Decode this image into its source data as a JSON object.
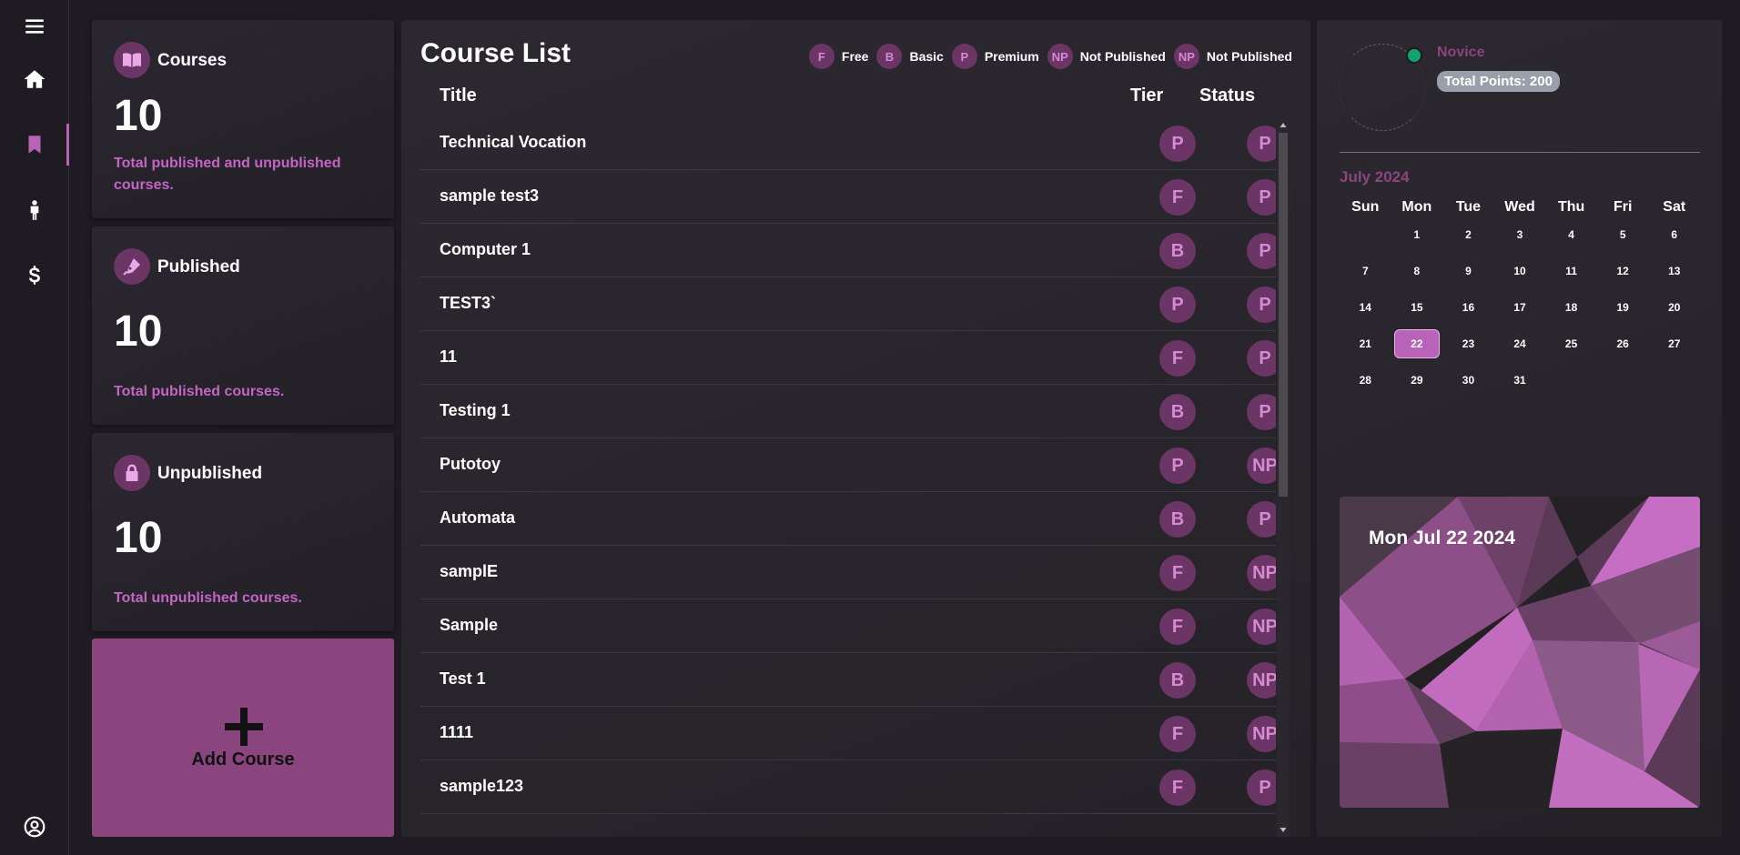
{
  "sidebar": {
    "icons": [
      "menu-icon",
      "home-icon",
      "bookmark-icon",
      "person-icon",
      "dollar-icon",
      "user-circle-icon"
    ],
    "active": "bookmark-icon",
    "accent": "#b863b7"
  },
  "stats": [
    {
      "title": "Courses",
      "value": "10",
      "desc": "Total published and unpublished courses.",
      "icon": "book-icon"
    },
    {
      "title": "Published",
      "value": "10",
      "desc": "Total published courses.",
      "icon": "pen-icon"
    },
    {
      "title": "Unpublished",
      "value": "10",
      "desc": "Total unpublished courses.",
      "icon": "lock-icon"
    }
  ],
  "add_course": {
    "label": "Add Course"
  },
  "course_list": {
    "title": "Course List",
    "legend": [
      {
        "badge": "F",
        "label": "Free"
      },
      {
        "badge": "B",
        "label": "Basic"
      },
      {
        "badge": "P",
        "label": "Premium"
      },
      {
        "badge": "NP",
        "label": "Not Published"
      },
      {
        "badge": "NP",
        "label": "Not Published"
      }
    ],
    "columns": {
      "title": "Title",
      "tier": "Tier",
      "status": "Status"
    },
    "rows": [
      {
        "title": "Technical Vocation",
        "tier": "P",
        "status": "P"
      },
      {
        "title": "sample test3",
        "tier": "F",
        "status": "P"
      },
      {
        "title": "Computer 1",
        "tier": "B",
        "status": "P"
      },
      {
        "title": "TEST3`",
        "tier": "P",
        "status": "P"
      },
      {
        "title": "11",
        "tier": "F",
        "status": "P"
      },
      {
        "title": "Testing 1",
        "tier": "B",
        "status": "P"
      },
      {
        "title": "Putotoy",
        "tier": "P",
        "status": "NP"
      },
      {
        "title": "Automata",
        "tier": "B",
        "status": "P"
      },
      {
        "title": "samplE",
        "tier": "F",
        "status": "NP"
      },
      {
        "title": "Sample",
        "tier": "F",
        "status": "NP"
      },
      {
        "title": "Test 1",
        "tier": "B",
        "status": "NP"
      },
      {
        "title": "1111",
        "tier": "F",
        "status": "NP"
      },
      {
        "title": "sample123",
        "tier": "F",
        "status": "P"
      }
    ]
  },
  "profile": {
    "rank": "Novice",
    "points": "Total Points: 200",
    "online_color": "#13a46d"
  },
  "calendar": {
    "month": "July 2024",
    "weekdays": [
      "Sun",
      "Mon",
      "Tue",
      "Wed",
      "Thu",
      "Fri",
      "Sat"
    ],
    "weeks": [
      [
        "",
        "1",
        "2",
        "3",
        "4",
        "5",
        "6"
      ],
      [
        "7",
        "8",
        "9",
        "10",
        "11",
        "12",
        "13"
      ],
      [
        "14",
        "15",
        "16",
        "17",
        "18",
        "19",
        "20"
      ],
      [
        "21",
        "22",
        "23",
        "24",
        "25",
        "26",
        "27"
      ],
      [
        "28",
        "29",
        "30",
        "31",
        "",
        "",
        ""
      ]
    ],
    "today": "22"
  },
  "date_card": {
    "text": "Mon Jul 22 2024"
  }
}
